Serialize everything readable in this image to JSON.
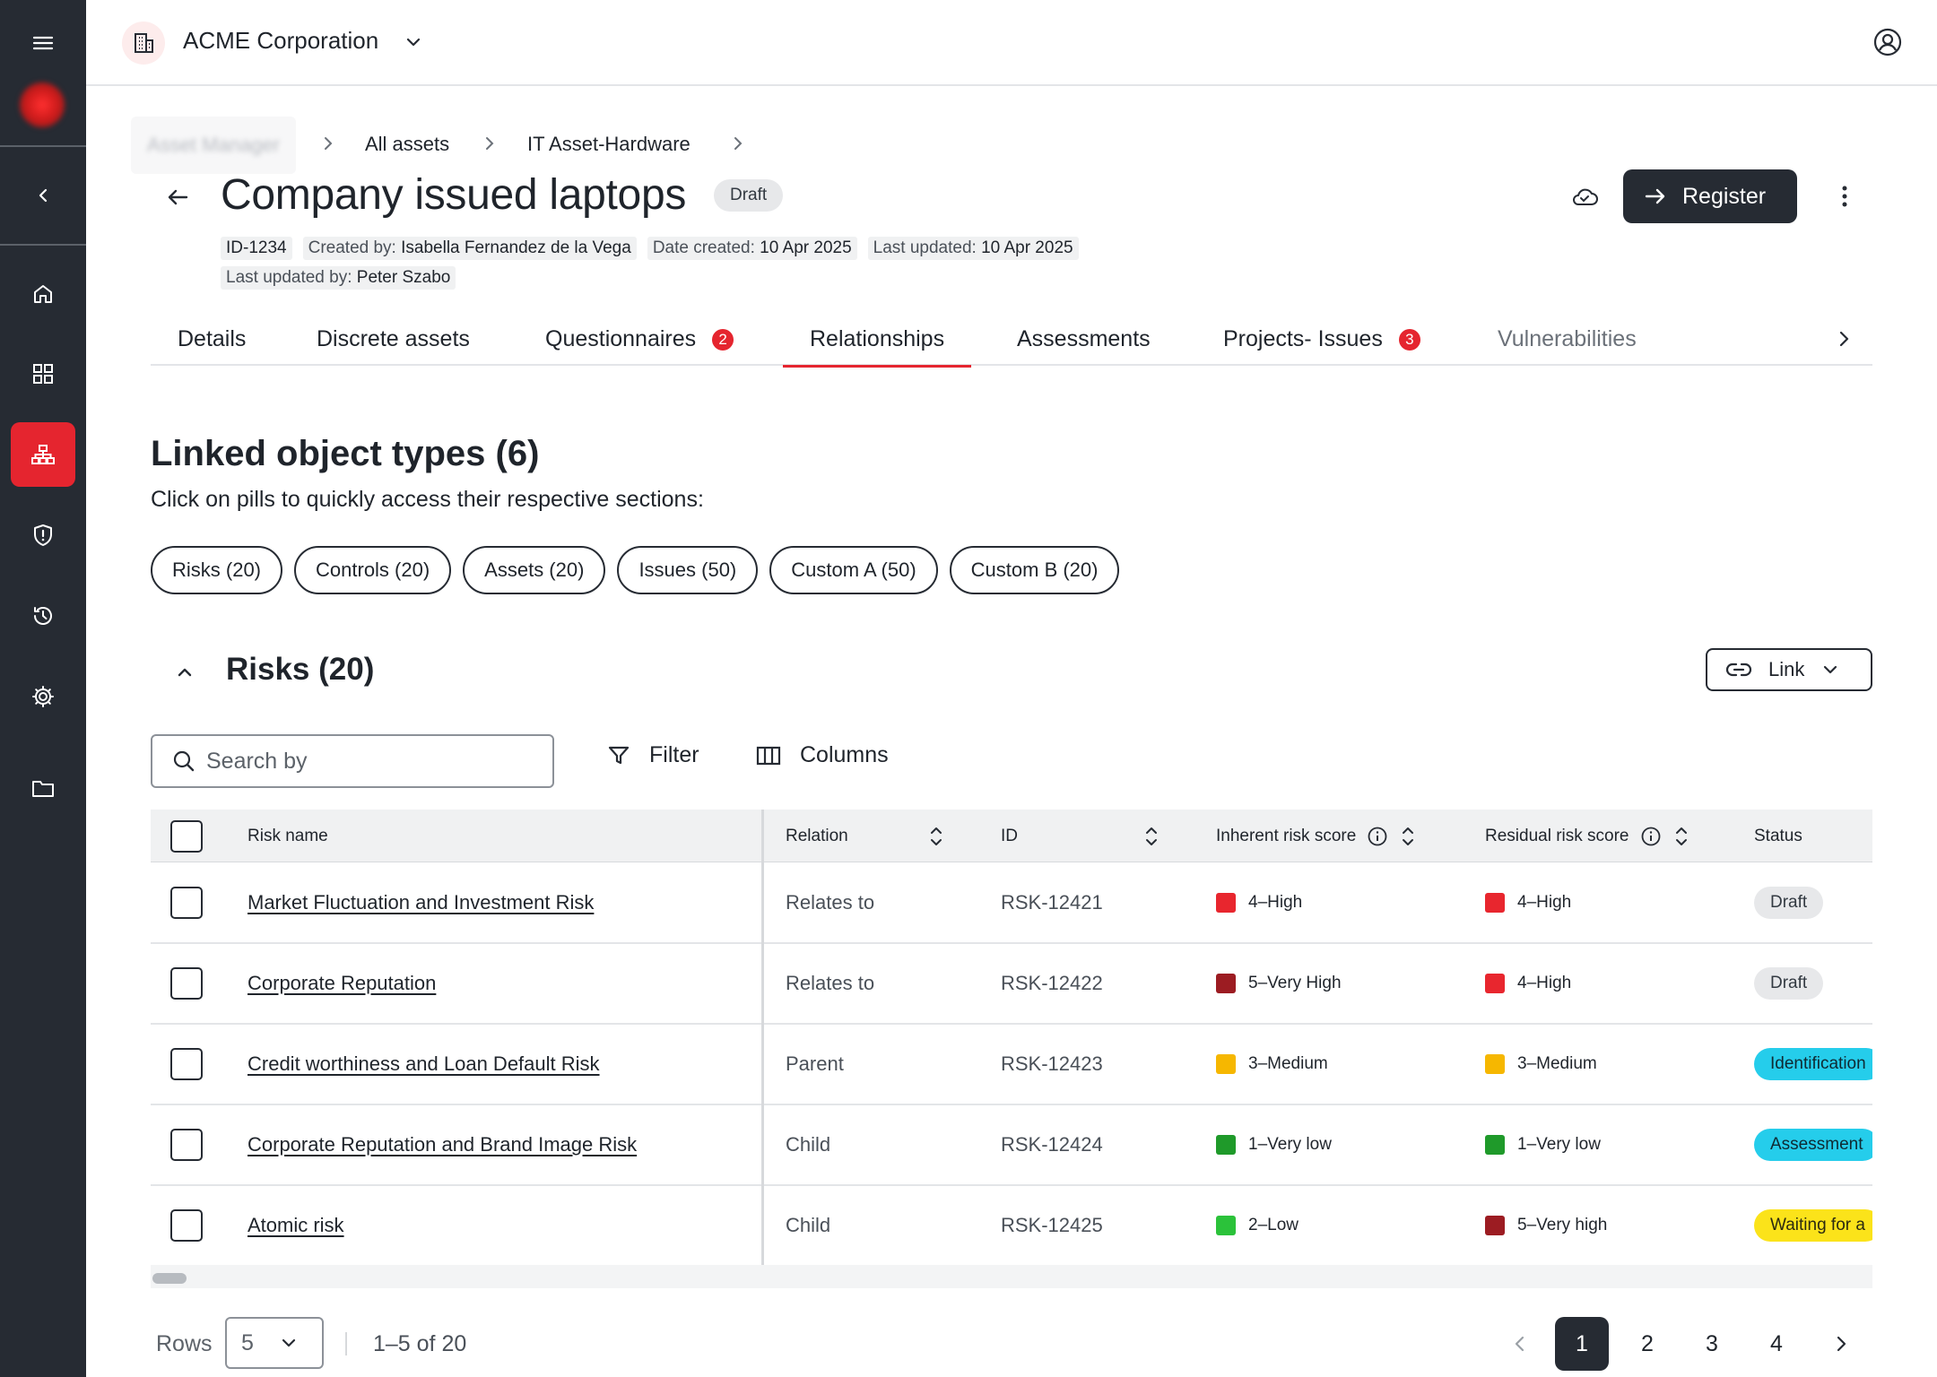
{
  "org": {
    "name": "ACME Corporation"
  },
  "breadcrumb": {
    "blurred": "Asset Manager",
    "items": [
      "All assets",
      "IT Asset-Hardware"
    ]
  },
  "page": {
    "title": "Company issued laptops",
    "status_badge": "Draft",
    "register_label": "Register"
  },
  "meta": {
    "id": "ID-1234",
    "created_by_label": "Created by:",
    "created_by": "Isabella Fernandez de la Vega",
    "date_created_label": "Date created:",
    "date_created": "10 Apr 2025",
    "last_updated_label": "Last updated:",
    "last_updated": "10 Apr 2025",
    "last_updated_by_label": "Last updated by:",
    "last_updated_by": "Peter Szabo"
  },
  "tabs": [
    {
      "label": "Details"
    },
    {
      "label": "Discrete assets"
    },
    {
      "label": "Questionnaires",
      "badge": "2"
    },
    {
      "label": "Relationships",
      "active": true
    },
    {
      "label": "Assessments"
    },
    {
      "label": "Projects- Issues",
      "badge": "3"
    },
    {
      "label": "Vulnerabilities"
    }
  ],
  "linked": {
    "title": "Linked object types (6)",
    "subtitle": "Click on pills to quickly access their respective sections:",
    "pills": [
      "Risks (20)",
      "Controls (20)",
      "Assets (20)",
      "Issues (50)",
      "Custom A (50)",
      "Custom B (20)"
    ]
  },
  "risks": {
    "title": "Risks (20)",
    "link_label": "Link",
    "search_placeholder": "Search by",
    "filter_label": "Filter",
    "columns_label": "Columns",
    "headers": {
      "name": "Risk name",
      "relation": "Relation",
      "id": "ID",
      "inherent": "Inherent risk score",
      "residual": "Residual risk score",
      "status": "Status"
    },
    "rows": [
      {
        "name": "Market Fluctuation and Investment Risk",
        "relation": "Relates to",
        "id": "RSK-12421",
        "inherent": "4–High",
        "inherent_color": "#e8262e",
        "residual": "4–High",
        "residual_color": "#e8262e",
        "status": "Draft",
        "status_bg": "#e7e8ea",
        "status_fg": "#333a42"
      },
      {
        "name": "Corporate Reputation",
        "relation": "Relates to",
        "id": "RSK-12422",
        "inherent": "5–Very High",
        "inherent_color": "#9c1c22",
        "residual": "4–High",
        "residual_color": "#e8262e",
        "status": "Draft",
        "status_bg": "#e7e8ea",
        "status_fg": "#333a42"
      },
      {
        "name": "Credit worthiness and Loan Default Risk",
        "relation": "Parent",
        "id": "RSK-12423",
        "inherent": "3–Medium",
        "inherent_color": "#f6b700",
        "residual": "3–Medium",
        "residual_color": "#f6b700",
        "status": "Identification",
        "status_bg": "#25cdeb",
        "status_fg": "#0f2a33"
      },
      {
        "name": "Corporate Reputation and Brand Image Risk",
        "relation": "Child",
        "id": "RSK-12424",
        "inherent": "1–Very low",
        "inherent_color": "#1f9a2a",
        "residual": "1–Very low",
        "residual_color": "#1f9a2a",
        "status": "Assessment",
        "status_bg": "#25cdeb",
        "status_fg": "#0f2a33"
      },
      {
        "name": "Atomic risk",
        "relation": "Child",
        "id": "RSK-12425",
        "inherent": "2–Low",
        "inherent_color": "#2bc23a",
        "residual": "5–Very high",
        "residual_color": "#9c1c22",
        "status": "Waiting for a",
        "status_bg": "#fbe31a",
        "status_fg": "#2b2a10"
      }
    ]
  },
  "footer": {
    "rows_label": "Rows",
    "rows_value": "5",
    "range": "1–5 of 20",
    "pages": [
      "1",
      "2",
      "3",
      "4"
    ],
    "current_page": "1"
  },
  "colors": {
    "sidebar": "#262b33",
    "accent": "#e5252f",
    "primary_button": "#262b33"
  }
}
